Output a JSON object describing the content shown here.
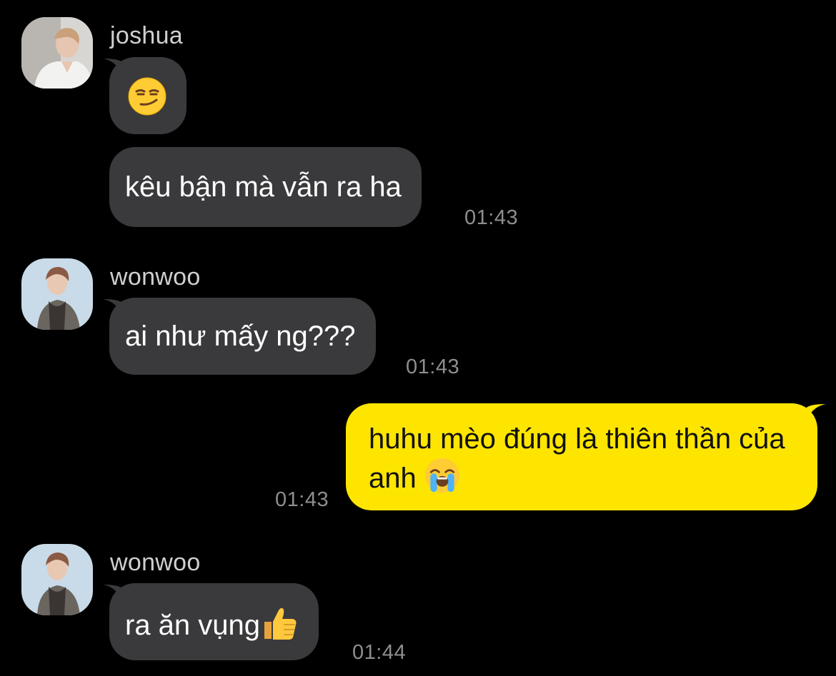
{
  "messages": [
    {
      "sender": "joshua",
      "text": "",
      "emoji": "smirking-face",
      "time": ""
    },
    {
      "sender": "",
      "text": "kêu bận mà vẫn ra ha",
      "time": "01:43"
    },
    {
      "sender": "wonwoo",
      "text": "ai như mấy ng???",
      "time": "01:43"
    },
    {
      "sender": "me",
      "text": "huhu mèo đúng là thiên thần của anh",
      "emoji": "loudly-crying-face",
      "time": "01:43"
    },
    {
      "sender": "wonwoo",
      "text": "ra ăn vụng",
      "emoji": "thumbs-up",
      "time": "01:44"
    }
  ],
  "colors": {
    "background": "#000000",
    "incoming_bubble": "#3a3a3c",
    "outgoing_bubble": "#fee500",
    "timestamp": "#8e8e8e",
    "sender_name": "#cfcfcf"
  }
}
